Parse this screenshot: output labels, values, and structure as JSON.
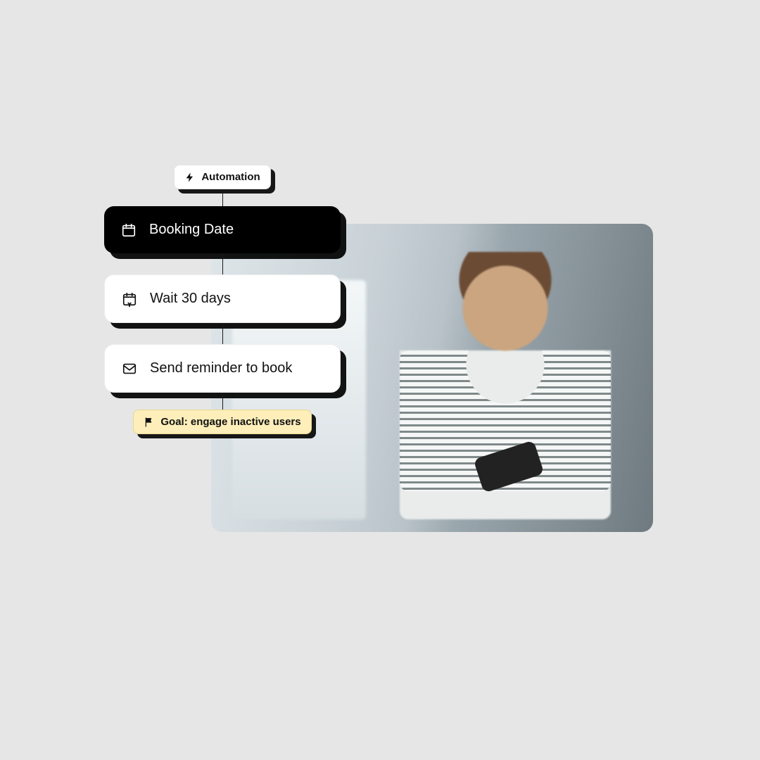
{
  "flow": {
    "header_badge": "Automation",
    "steps": [
      {
        "label": "Booking Date",
        "icon": "calendar-icon",
        "variant": "dark"
      },
      {
        "label": "Wait 30 days",
        "icon": "wait-calendar-icon",
        "variant": "light"
      },
      {
        "label": "Send reminder to book",
        "icon": "mail-icon",
        "variant": "light"
      }
    ],
    "footer_badge": "Goal: engage inactive users"
  },
  "hero": {
    "alt": "Person looking at a phone"
  }
}
